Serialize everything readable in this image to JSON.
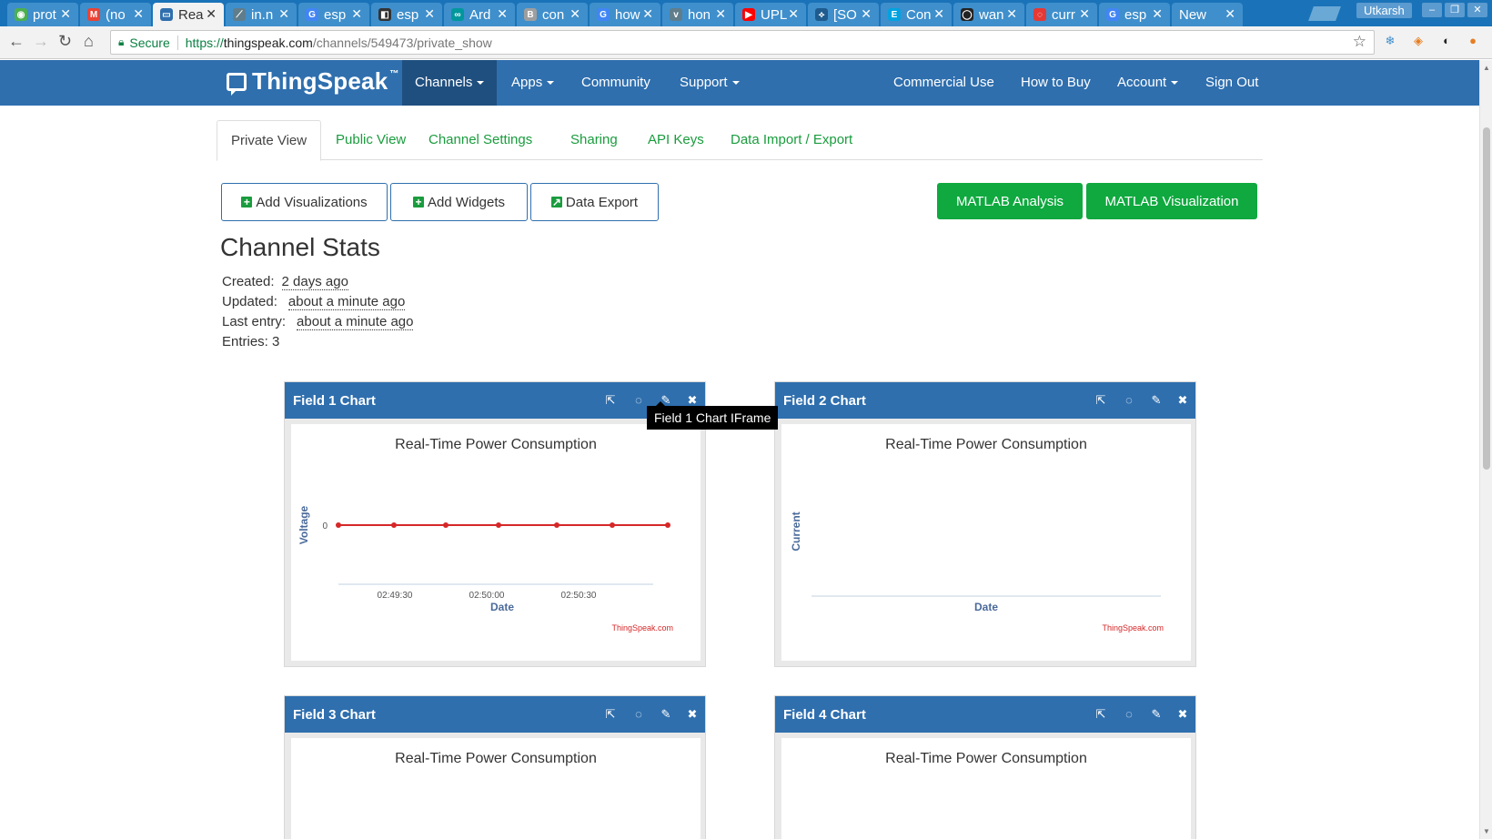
{
  "browser": {
    "tabs": [
      {
        "label": "prot",
        "color": "#4caf50",
        "glyph": "◉"
      },
      {
        "label": "(no",
        "color": "#ea4335",
        "glyph": "M"
      },
      {
        "label": "Rea",
        "color": "#2f6fae",
        "glyph": "▭"
      },
      {
        "label": "in.n",
        "color": "#607d8b",
        "glyph": "⟋"
      },
      {
        "label": "esp",
        "color": "#4285f4",
        "glyph": "G"
      },
      {
        "label": "esp",
        "color": "#333333",
        "glyph": "◧"
      },
      {
        "label": "Ard",
        "color": "#00979d",
        "glyph": "∞"
      },
      {
        "label": "con",
        "color": "#9e9e9e",
        "glyph": "B"
      },
      {
        "label": "how",
        "color": "#4285f4",
        "glyph": "G"
      },
      {
        "label": "hon",
        "color": "#607d8b",
        "glyph": "v"
      },
      {
        "label": "UPL",
        "color": "#ff0000",
        "glyph": "▶"
      },
      {
        "label": "[SO",
        "color": "#1e5b8e",
        "glyph": "⟡"
      },
      {
        "label": "Con",
        "color": "#00a3e0",
        "glyph": "E"
      },
      {
        "label": "wan",
        "color": "#222222",
        "glyph": "◯"
      },
      {
        "label": "curr",
        "color": "#e53935",
        "glyph": "◌"
      },
      {
        "label": "esp",
        "color": "#4285f4",
        "glyph": "G"
      },
      {
        "label": "New T",
        "color": "#3f8fcc",
        "glyph": ""
      }
    ],
    "active_tab_index": 2,
    "user": "Utkarsh",
    "secure_label": "Secure",
    "url_scheme": "https://",
    "url_host": "thingspeak.com",
    "url_path": "/channels/549473/private_show"
  },
  "navbar": {
    "logo": "ThingSpeak",
    "tm": "™",
    "items": [
      {
        "label": "Channels",
        "dropdown": true,
        "active": true
      },
      {
        "label": "Apps",
        "dropdown": true
      },
      {
        "label": "Community",
        "dropdown": false
      },
      {
        "label": "Support",
        "dropdown": true
      }
    ],
    "right_items": [
      {
        "label": "Commercial Use",
        "dropdown": false
      },
      {
        "label": "How to Buy",
        "dropdown": false
      },
      {
        "label": "Account",
        "dropdown": true
      },
      {
        "label": "Sign Out",
        "dropdown": false
      }
    ]
  },
  "channel_tabs": [
    "Private View",
    "Public View",
    "Channel Settings",
    "Sharing",
    "API Keys",
    "Data Import / Export"
  ],
  "actions": {
    "add_visualizations": "Add Visualizations",
    "add_widgets": "Add Widgets",
    "data_export": "Data Export",
    "matlab_analysis": "MATLAB Analysis",
    "matlab_visualization": "MATLAB Visualization"
  },
  "stats": {
    "title": "Channel Stats",
    "created_label": "Created:",
    "created_value": "2 days ago",
    "updated_label": "Updated:",
    "updated_value": "about a minute ago",
    "last_entry_label": "Last entry:",
    "last_entry_value": "about a minute ago",
    "entries_label": "Entries:",
    "entries_value": "3"
  },
  "tooltip": "Field 1 Chart IFrame",
  "colors": {
    "navbar": "#2f6fae",
    "accent_green": "#0fa93f",
    "series": "#d62728"
  },
  "icons": [
    "external-link-icon",
    "comment-icon",
    "pencil-icon",
    "close-icon"
  ],
  "chart_data": [
    {
      "type": "line",
      "card_title": "Field 1 Chart",
      "title": "Real-Time Power Consumption",
      "xlabel": "Date",
      "ylabel": "Voltage",
      "credit": "ThingSpeak.com",
      "x_ticks": [
        "02:49:30",
        "02:50:00",
        "02:50:30"
      ],
      "y_ticks": [
        "0"
      ],
      "series": [
        {
          "values": [
            0,
            0,
            0,
            0,
            0,
            0,
            0
          ]
        }
      ]
    },
    {
      "type": "line",
      "card_title": "Field 2 Chart",
      "title": "Real-Time Power Consumption",
      "xlabel": "Date",
      "ylabel": "Current",
      "credit": "ThingSpeak.com",
      "x_ticks": [],
      "y_ticks": [],
      "series": []
    },
    {
      "type": "line",
      "card_title": "Field 3 Chart",
      "title": "Real-Time Power Consumption"
    },
    {
      "type": "line",
      "card_title": "Field 4 Chart",
      "title": "Real-Time Power Consumption"
    }
  ]
}
